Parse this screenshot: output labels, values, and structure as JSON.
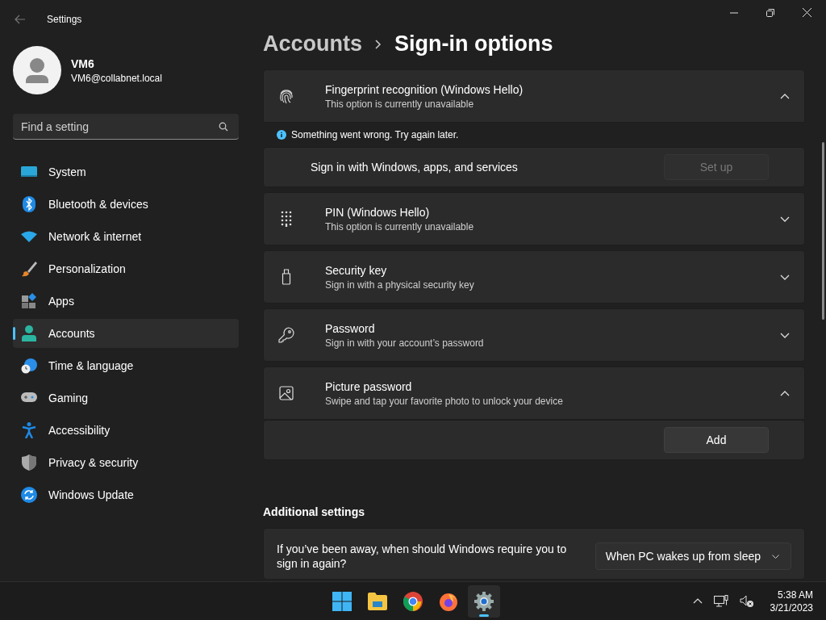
{
  "window": {
    "title": "Settings"
  },
  "user": {
    "name": "VM6",
    "email": "VM6@collabnet.local"
  },
  "search": {
    "placeholder": "Find a setting"
  },
  "nav": [
    {
      "label": "System",
      "selected": false
    },
    {
      "label": "Bluetooth & devices",
      "selected": false
    },
    {
      "label": "Network & internet",
      "selected": false
    },
    {
      "label": "Personalization",
      "selected": false
    },
    {
      "label": "Apps",
      "selected": false
    },
    {
      "label": "Accounts",
      "selected": true
    },
    {
      "label": "Time & language",
      "selected": false
    },
    {
      "label": "Gaming",
      "selected": false
    },
    {
      "label": "Accessibility",
      "selected": false
    },
    {
      "label": "Privacy & security",
      "selected": false
    },
    {
      "label": "Windows Update",
      "selected": false
    }
  ],
  "breadcrumb": {
    "parent": "Accounts",
    "current": "Sign-in options"
  },
  "items": [
    {
      "kind": "expander",
      "title": "Fingerprint recognition (Windows Hello)",
      "subtitle": "This option is currently unavailable",
      "expanded": true
    },
    {
      "kind": "message",
      "text": "Something went wrong. Try again later."
    },
    {
      "kind": "action",
      "label": "Sign in with Windows, apps, and services",
      "button": "Set up",
      "disabled": true
    },
    {
      "kind": "expander",
      "title": "PIN (Windows Hello)",
      "subtitle": "This option is currently unavailable",
      "expanded": false
    },
    {
      "kind": "expander",
      "title": "Security key",
      "subtitle": "Sign in with a physical security key",
      "expanded": false
    },
    {
      "kind": "expander",
      "title": "Password",
      "subtitle": "Sign in with your account’s password",
      "expanded": false
    },
    {
      "kind": "expander",
      "title": "Picture password",
      "subtitle": "Swipe and tap your favorite photo to unlock your device",
      "expanded": true
    },
    {
      "kind": "action",
      "button": "Add",
      "disabled": false
    }
  ],
  "additional": {
    "heading": "Additional settings",
    "setting": {
      "label": "If you’ve been away, when should Windows require you to sign in again?",
      "value": "When PC wakes up from sleep"
    }
  },
  "taskbar": {
    "apps": [
      {
        "selected": false
      },
      {
        "selected": false
      },
      {
        "selected": false
      },
      {
        "selected": false
      },
      {
        "selected": true
      }
    ],
    "time": "5:38 AM",
    "date": "3/21/2023"
  }
}
